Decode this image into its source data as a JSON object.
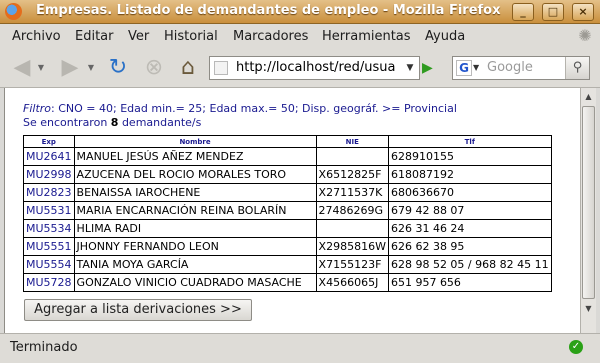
{
  "window": {
    "title": "Empresas. Listado de demandantes de empleo - Mozilla Firefox"
  },
  "menu": [
    "Archivo",
    "Editar",
    "Ver",
    "Historial",
    "Marcadores",
    "Herramientas",
    "Ayuda"
  ],
  "toolbar": {
    "url": "http://localhost/red/usua",
    "search_placeholder": "Google"
  },
  "page": {
    "filter_label": "Filtro",
    "filter_text": ": CNO = 40; Edad min.= 25; Edad max.= 50; Disp. geográf. >= Provincial",
    "found_prefix": "Se encontraron ",
    "found_count": "8",
    "found_suffix": " demandante/s",
    "columns": [
      "Exp",
      "Nombre",
      "NIE",
      "Tlf"
    ],
    "rows": [
      [
        "MU2641",
        "MANUEL JESÚS AÑEZ MENDEZ",
        "",
        "628910155"
      ],
      [
        "MU2998",
        "AZUCENA DEL ROCIO MORALES TORO",
        "X6512825F",
        "618087192"
      ],
      [
        "MU2823",
        "BENAISSA IAROCHENE",
        "X2711537K",
        "680636670"
      ],
      [
        "MU5531",
        "MARIA ENCARNACIÓN REINA BOLARÍN",
        "27486269G",
        "679 42 88 07"
      ],
      [
        "MU5534",
        "HLIMA RADI",
        "",
        "626 31 46 24"
      ],
      [
        "MU5551",
        "JHONNY FERNANDO LEON",
        "X2985816W",
        "626 62 38 95"
      ],
      [
        "MU5554",
        "TANIA MOYA GARCÍA",
        "X7155123F",
        "628 98 52 05 / 968 82 45 11"
      ],
      [
        "MU5728",
        "GONZALO VINICIO CUADRADO MASACHE",
        "X4566065J",
        "651 957 656"
      ]
    ],
    "add_button": "Agregar a lista derivaciones >>"
  },
  "status": {
    "text": "Terminado"
  }
}
